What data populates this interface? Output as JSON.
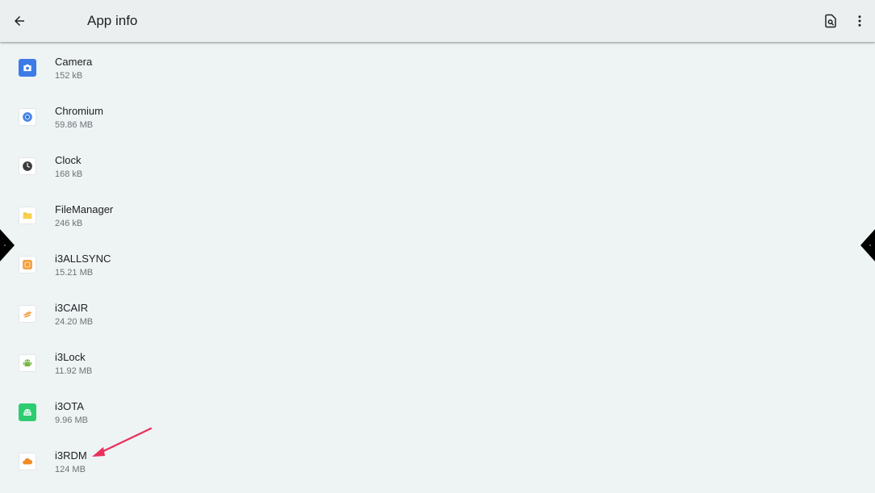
{
  "header": {
    "title": "App info",
    "back_icon": "arrow-back-icon",
    "actions": [
      "storage-search-icon",
      "more-vert-icon"
    ]
  },
  "apps": [
    {
      "name": "Camera",
      "size": "152 kB",
      "icon": "camera-icon",
      "color": "#3d7be6"
    },
    {
      "name": "Chromium",
      "size": "59.86 MB",
      "icon": "chromium-icon",
      "color": "#4a86e8"
    },
    {
      "name": "Clock",
      "size": "168 kB",
      "icon": "clock-icon",
      "color": "#3b3b3b"
    },
    {
      "name": "FileManager",
      "size": "246 kB",
      "icon": "folder-icon",
      "color": "#f4c430"
    },
    {
      "name": "i3ALLSYNC",
      "size": "15.21 MB",
      "icon": "i3allsync-icon",
      "color": "#f39c3a"
    },
    {
      "name": "i3CAIR",
      "size": "24.20 MB",
      "icon": "i3cair-icon",
      "color": "#f08a24"
    },
    {
      "name": "i3Lock",
      "size": "11.92 MB",
      "icon": "android-icon",
      "color": "#78b642"
    },
    {
      "name": "i3OTA",
      "size": "9.96 MB",
      "icon": "android-grid-icon",
      "color": "#2ecc71"
    },
    {
      "name": "i3RDM",
      "size": "124 MB",
      "icon": "cloud-icon",
      "color": "#f08a24"
    }
  ],
  "annotation_color": "#e8305a"
}
